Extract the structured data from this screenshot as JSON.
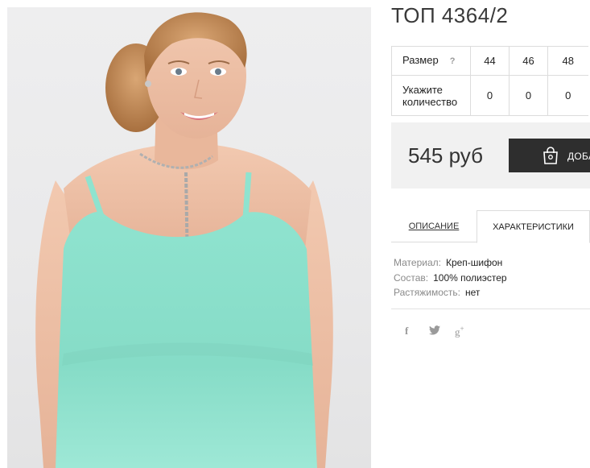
{
  "product": {
    "title": "ТОП 4364/2",
    "image_alt": "Модель в мятном топе на бретелях"
  },
  "sizes": {
    "row_label": "Размер",
    "help": "?",
    "values": [
      "44",
      "46",
      "48"
    ],
    "qty_label_line1": "Укажите",
    "qty_label_line2": "количество",
    "quantities": [
      "0",
      "0",
      "0"
    ]
  },
  "buy": {
    "price": "545 руб",
    "cart_label": "ДОБА",
    "cart_icon": "shopping-bag-icon"
  },
  "tabs": [
    {
      "label": "ОПИСАНИЕ"
    },
    {
      "label": "ХАРАКТЕРИСТИКИ"
    }
  ],
  "specs": [
    {
      "key": "Материал:",
      "value": "Креп-шифон"
    },
    {
      "key": "Состав:",
      "value": "100% полиэстер"
    },
    {
      "key": "Растяжимость:",
      "value": "нет"
    }
  ],
  "social": [
    {
      "icon": "facebook-icon",
      "glyph": "f"
    },
    {
      "icon": "twitter-icon",
      "glyph": "🐦"
    },
    {
      "icon": "googleplus-icon",
      "glyph": "g"
    }
  ],
  "colors": {
    "top": "#8fe3cf",
    "button": "#2e2e2e",
    "buybox_bg": "#f1f1f1"
  }
}
